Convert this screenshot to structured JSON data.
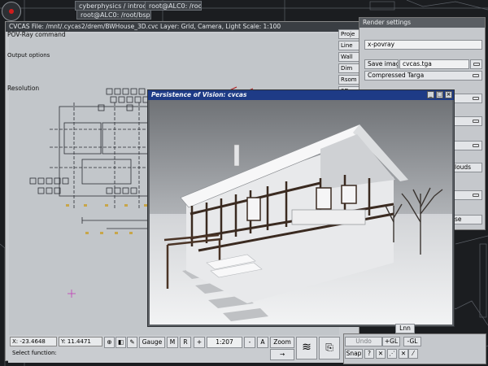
{
  "taskbar": {
    "tab1": "cyberphysics / introduction - Mozilla",
    "tab2": "root@ALC0: /root/bsp",
    "tab3": "root@ALC0: /root/tmp"
  },
  "cvcas": {
    "title": "CVCAS File: /mnt/.cycas2/drem/BWHouse_3D.cvc  Layer: Grid, Camera, Light  Scale: 1:100",
    "side_buttons": [
      "Proje",
      "Line",
      "Wall",
      "Dim",
      "Rsom",
      "3D"
    ]
  },
  "status": {
    "x_coord": "X: -23.4648",
    "y_coord": "Y: 11.4471",
    "prompt": "Select function:",
    "gauge_label": "Gauge",
    "m_label": "M",
    "r_label": "R",
    "plus_label": "+",
    "scale_value": "1:207",
    "minus_label": "-",
    "a_label": "A",
    "zoom_label": "Zoom",
    "arrow_label": "→"
  },
  "render": {
    "title": "Render settings",
    "povray_label": "POV-Ray command",
    "povray_value": "x-povray",
    "output_label": "Output options",
    "save_image_label": "Save image",
    "save_image_value": "cvcas.tga",
    "format_value": "Compressed Targa",
    "resolution_label": "Resolution",
    "clouds_fragment": "louds",
    "close_fragment": "se"
  },
  "pov": {
    "title": "Persistence of Vision: cvcas"
  },
  "snap": {
    "undo": "Undo",
    "snap": "Snap",
    "question": "?",
    "gl_plus": "+GL",
    "gl_minus": "-GL",
    "link_fragment": "Lnn"
  },
  "colors": {
    "desktop": "#1b1d20",
    "window_bg": "#c9ccd0",
    "pov_title_bar": "#1e3b86",
    "canvas": "#c2c6ca",
    "plan_lines": "#2b2e33",
    "plan_accent": "#c8a64a",
    "roof_stroke": "#b01c1c"
  }
}
